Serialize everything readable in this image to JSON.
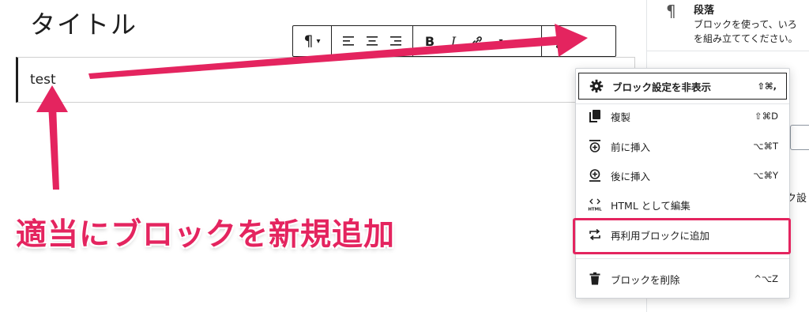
{
  "editor": {
    "title": "タイトル",
    "paragraph_text": "test"
  },
  "toolbar": {
    "block_type_glyph": "¶",
    "block_type_caret": "▾",
    "align_left_icon": "align-left-icon",
    "align_center_icon": "align-center-icon",
    "align_right_icon": "align-right-icon",
    "bold_label": "B",
    "italic_label": "I",
    "link_icon": "link-icon",
    "more_icon": "more-vertical-icon"
  },
  "sidebar": {
    "block_icon": "¶",
    "block_title": "段落",
    "block_desc_line1": "ブロックを使って、いろ",
    "block_desc_line2": "を組み立ててください。",
    "partial_label": "ク設"
  },
  "menu": {
    "items": [
      {
        "label": "ブロック設定を非表示",
        "shortcut": "⇧⌘,",
        "icon": "gear-icon"
      },
      {
        "label": "複製",
        "shortcut": "⇧⌘D",
        "icon": "duplicate-icon"
      },
      {
        "label": "前に挿入",
        "shortcut": "⌥⌘T",
        "icon": "insert-before-icon"
      },
      {
        "label": "後に挿入",
        "shortcut": "⌥⌘Y",
        "icon": "insert-after-icon"
      },
      {
        "label": "HTML として編集",
        "shortcut": "",
        "icon": "html-icon"
      },
      {
        "label": "再利用ブロックに追加",
        "shortcut": "",
        "icon": "reusable-block-icon"
      },
      {
        "label": "ブロックを削除",
        "shortcut": "^⌥Z",
        "icon": "trash-icon"
      }
    ]
  },
  "annotation": {
    "text": "適当にブロックを新規追加",
    "color": "#e4245f"
  }
}
